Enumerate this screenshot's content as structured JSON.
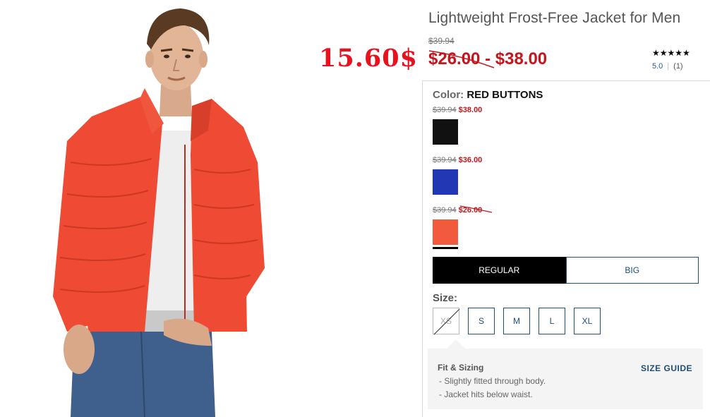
{
  "product": {
    "title": "Lightweight Frost-Free Jacket for Men",
    "original_price": "$39.94",
    "promo_price": "15.60$",
    "sale_low": "$26.00",
    "sale_sep": "-",
    "sale_high": "$38.00"
  },
  "rating": {
    "stars": "★★★★★",
    "score": "5.0",
    "count": "(1)"
  },
  "color": {
    "label": "Color:",
    "selected": "RED BUTTONS",
    "swatches": [
      {
        "was": "$39.94",
        "now": "$38.00",
        "color": "#111111",
        "icon": "black-swatch"
      },
      {
        "was": "$39.94",
        "now": "$36.00",
        "color": "#2137b4",
        "icon": "blue-swatch"
      },
      {
        "was": "$39.94",
        "now": "$26.00",
        "color": "#f25a3e",
        "icon": "red-swatch"
      }
    ]
  },
  "fit": {
    "options": [
      "REGULAR",
      "BIG"
    ],
    "selected": "REGULAR"
  },
  "size": {
    "label": "Size:",
    "options": [
      "XS",
      "S",
      "M",
      "L",
      "XL"
    ],
    "unavailable": [
      "XS"
    ]
  },
  "fit_sizing": {
    "title": "Fit & Sizing",
    "guide_label": "SIZE GUIDE",
    "lines": [
      "- Slightly fitted through body.",
      "- Jacket hits below waist."
    ]
  },
  "colors": {
    "sale_red": "#c4161c",
    "promo_red": "#e8121f",
    "link_blue": "#1f4e79",
    "jacket": "#ee4a34"
  }
}
